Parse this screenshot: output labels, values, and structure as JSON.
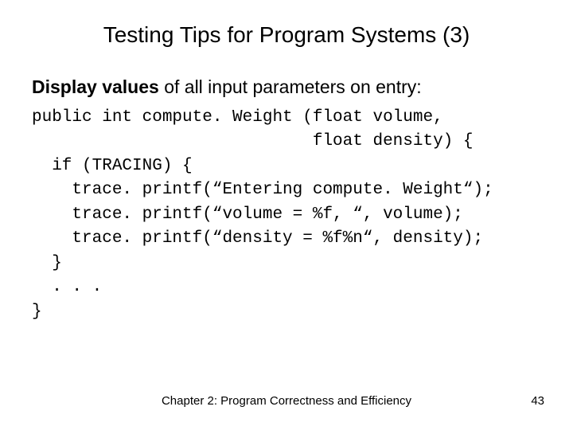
{
  "title": "Testing Tips for Program Systems (3)",
  "subtitle_bold": "Display values",
  "subtitle_rest": " of all input parameters on entry:",
  "code_block": "public int compute. Weight (float volume,\n                            float density) {\n  if (TRACING) {\n    trace. printf(“Entering compute. Weight“);\n    trace. printf(“volume = %f, “, volume);\n    trace. printf(“density = %f%n“, density);\n  }\n  . . .\n}",
  "footer_center": "Chapter 2: Program Correctness and Efficiency",
  "page_number": "43"
}
